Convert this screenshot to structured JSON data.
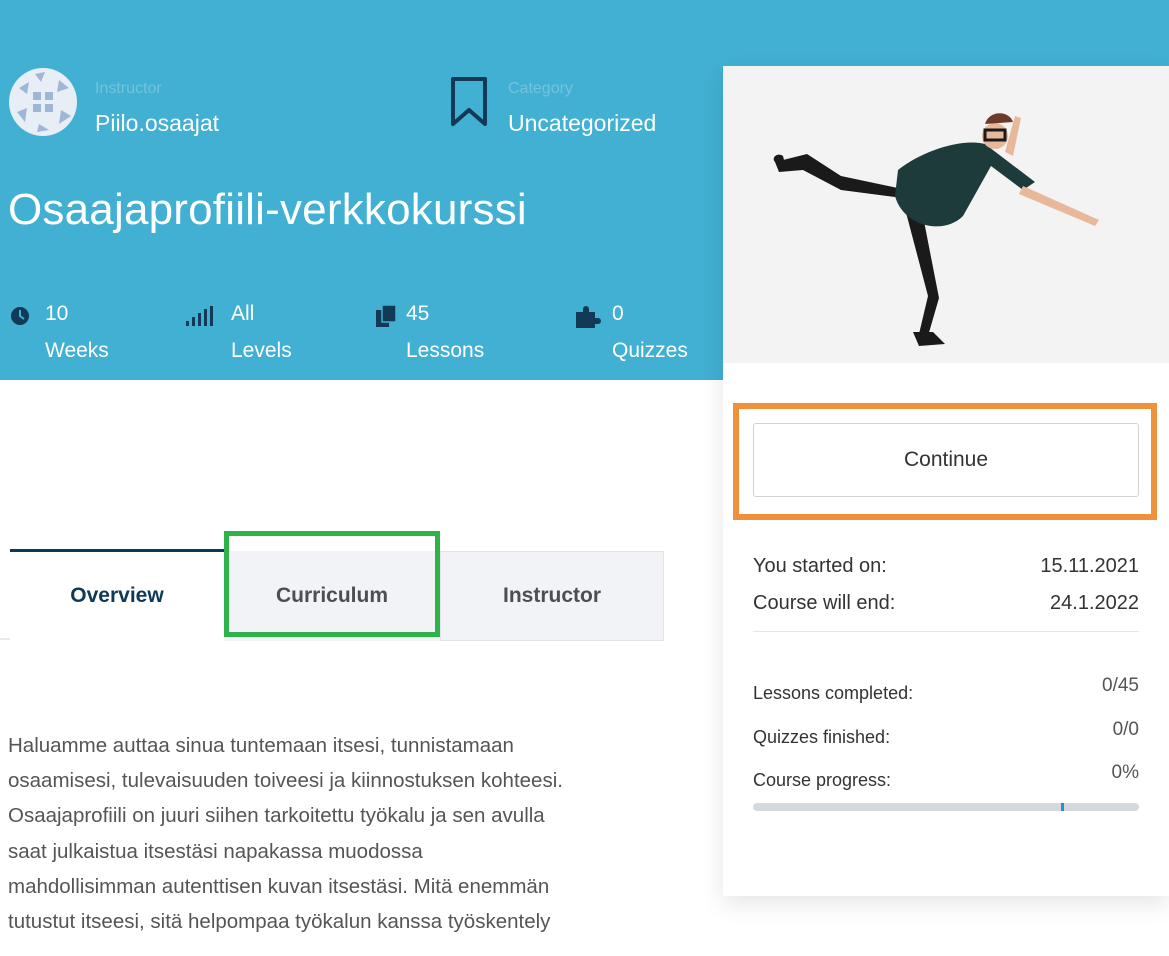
{
  "header": {
    "instructor_label": "Instructor",
    "instructor_name": "Piilo.osaajat",
    "category_label": "Category",
    "category_name": "Uncategorized",
    "course_title": "Osaajaprofiili-verkkokurssi"
  },
  "stats": [
    {
      "num": "10",
      "unit": "Weeks",
      "icon": "clock-icon"
    },
    {
      "num": "All",
      "unit": "Levels",
      "icon": "signal-bars-icon"
    },
    {
      "num": "45",
      "unit": "Lessons",
      "icon": "documents-icon"
    },
    {
      "num": "0",
      "unit": "Quizzes",
      "icon": "puzzle-icon"
    }
  ],
  "tabs": {
    "overview": "Overview",
    "curriculum": "Curriculum",
    "instructor": "Instructor"
  },
  "description_lines": [
    "Haluamme auttaa sinua tuntemaan itsesi, tunnistamaan",
    "osaamisesi, tulevaisuuden toiveesi ja kiinnostuksen kohteesi.",
    "Osaajaprofiili on juuri siihen tarkoitettu työkalu ja sen avulla",
    "saat julkaistua itsestäsi napakassa muodossa",
    "mahdollisimman autenttisen kuvan itsestäsi. Mitä enemmän",
    "tutustut itseesi, sitä helpompaa työkalun kanssa työskentely"
  ],
  "sidebar": {
    "continue_label": "Continue",
    "started_label": "You started on:",
    "started_value": "15.11.2021",
    "end_label": "Course will end:",
    "end_value": "24.1.2022",
    "lessons_label": "Lessons completed:",
    "lessons_value": "0/45",
    "quizzes_label": "Quizzes finished:",
    "quizzes_value": "0/0",
    "progress_label": "Course progress:",
    "progress_value": "0%",
    "progress_fraction": 0.0
  },
  "colors": {
    "hero": "#41b0d2",
    "tab_active": "#0e3a57",
    "highlight_orange": "#f0903a",
    "highlight_green": "#2fb24a"
  }
}
